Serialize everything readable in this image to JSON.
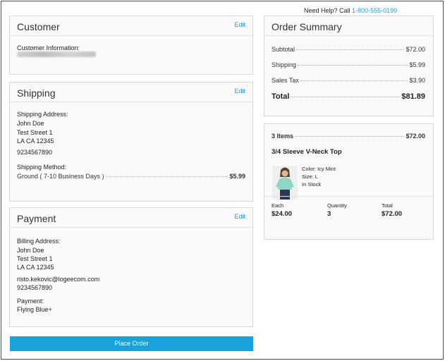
{
  "help": {
    "prefix": "Need Help? Call ",
    "phone": "1-800-555-0199"
  },
  "customer": {
    "title": "Customer",
    "edit_label": "Edit",
    "info_label": "Customer Information:"
  },
  "shipping": {
    "title": "Shipping",
    "edit_label": "Edit",
    "address_label": "Shipping Address:",
    "name": "John Doe",
    "street": "Test Street 1",
    "city": "LA CA 12345",
    "phone": "9234567890",
    "method_label": "Shipping Method:",
    "method": "Ground ( 7-10 Business Days )",
    "method_price": "$5.99"
  },
  "payment": {
    "title": "Payment",
    "edit_label": "Edit",
    "billing_label": "Billing Address:",
    "name": "John Doe",
    "street": "Test Street 1",
    "city": "LA CA 12345",
    "email": "risto.kekovic@logeecom.com",
    "phone": "9234567890",
    "payment_label": "Payment:",
    "payment_method": "Flying Blue+"
  },
  "place_order_label": "Place Order",
  "summary": {
    "title": "Order Summary",
    "rows": [
      {
        "label": "Subtotal",
        "value": "$72.00"
      },
      {
        "label": "Shipping",
        "value": "$5.99"
      },
      {
        "label": "Sales Tax",
        "value": "$3.90"
      }
    ],
    "total_label": "Total",
    "total_value": "$81.89"
  },
  "cart": {
    "items_label": "3 Items",
    "items_value": "$72.00",
    "product_name": "3/4 Sleeve V-Neck Top",
    "color": "Color: Icy Mint",
    "size": "Size: L",
    "stock": "In Stock",
    "each_label": "Each",
    "each_value": "$24.00",
    "qty_label": "Quantity",
    "qty_value": "3",
    "total_label": "Total",
    "total_value": "$72.00"
  },
  "colors": {
    "accent": "#1aa2dc",
    "shirt": "#8fd6c4"
  }
}
